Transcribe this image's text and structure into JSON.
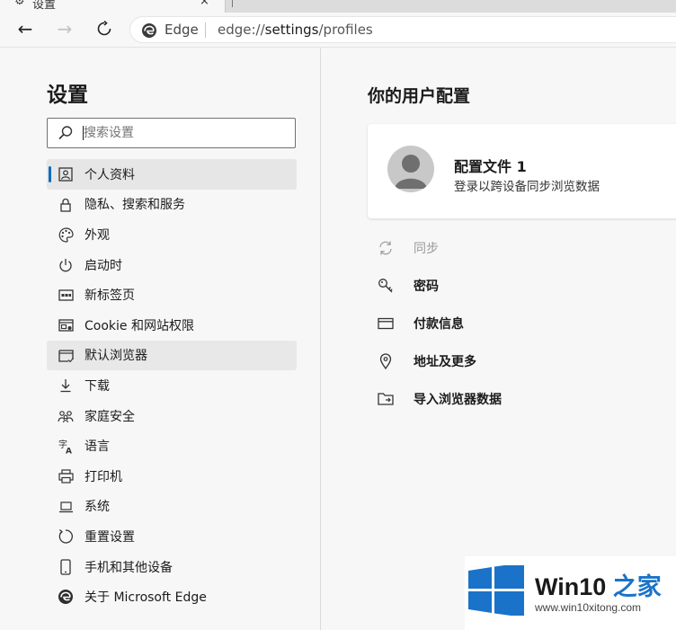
{
  "tab": {
    "title": "设置",
    "close_label": "×"
  },
  "toolbar": {
    "back_label": "←",
    "forward_label": "→",
    "address": {
      "brand": "Edge",
      "scheme": "edge://",
      "host": "settings",
      "path": "/profiles"
    }
  },
  "sidebar": {
    "title": "设置",
    "search_placeholder": "搜索设置",
    "items": [
      {
        "label": "个人资料",
        "icon": "profile-icon",
        "selected": true
      },
      {
        "label": "隐私、搜索和服务",
        "icon": "lock-icon"
      },
      {
        "label": "外观",
        "icon": "palette-icon"
      },
      {
        "label": "启动时",
        "icon": "power-icon"
      },
      {
        "label": "新标签页",
        "icon": "new-tab-icon"
      },
      {
        "label": "Cookie 和网站权限",
        "icon": "site-permissions-icon"
      },
      {
        "label": "默认浏览器",
        "icon": "browser-icon",
        "hovered": true
      },
      {
        "label": "下载",
        "icon": "download-icon"
      },
      {
        "label": "家庭安全",
        "icon": "family-icon"
      },
      {
        "label": "语言",
        "icon": "language-icon"
      },
      {
        "label": "打印机",
        "icon": "printer-icon"
      },
      {
        "label": "系统",
        "icon": "laptop-icon"
      },
      {
        "label": "重置设置",
        "icon": "reset-icon"
      },
      {
        "label": "手机和其他设备",
        "icon": "phone-icon"
      },
      {
        "label": "关于 Microsoft Edge",
        "icon": "edge-logo-icon"
      }
    ]
  },
  "main": {
    "title": "你的用户配置",
    "profile": {
      "name": "配置文件 1",
      "subtitle": "登录以跨设备同步浏览数据"
    },
    "options": [
      {
        "label": "同步",
        "icon": "sync-icon",
        "disabled": true
      },
      {
        "label": "密码",
        "icon": "key-icon"
      },
      {
        "label": "付款信息",
        "icon": "card-icon"
      },
      {
        "label": "地址及更多",
        "icon": "location-pin-icon"
      },
      {
        "label": "导入浏览器数据",
        "icon": "import-icon"
      }
    ]
  },
  "watermark": {
    "title_main": "Win10",
    "title_accent": "之家",
    "url": "www.win10xitong.com"
  },
  "colors": {
    "accent": "#0f6cbd",
    "win_blue": "#1a73c9",
    "background": "#f7f7f7"
  }
}
